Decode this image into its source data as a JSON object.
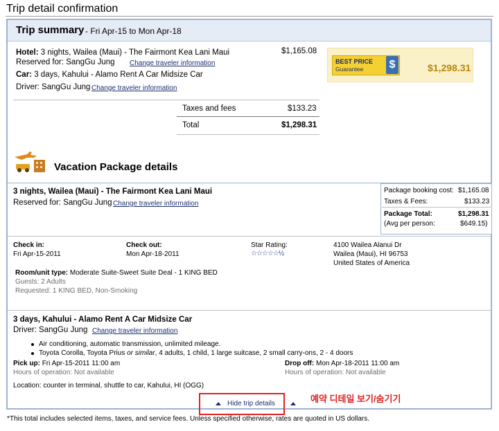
{
  "page_title": "Trip detail confirmation",
  "summary": {
    "title": "Trip summary",
    "dates": "- Fri Apr-15 to Mon Apr-18",
    "hotel_label": "Hotel:",
    "hotel_text": "3 nights, Wailea (Maui) - The Fairmont Kea Lani Maui",
    "hotel_price": "$1,165.08",
    "hotel_reserved": "Reserved for: SangGu  Jung",
    "change_link": "Change traveler information",
    "car_label": "Car:",
    "car_text": "3 days, Kahului - Alamo Rent A Car Midsize Car",
    "car_driver": "Driver: SangGu Jung",
    "taxes_label": "Taxes and fees",
    "taxes_value": "$133.23",
    "total_label": "Total",
    "total_value": "$1,298.31",
    "badge_line1": "BEST PRICE",
    "badge_line2": "Guarantee",
    "badge_symbol": "$",
    "box_total": "$1,298.31"
  },
  "vacation": {
    "title": "Vacation Package details",
    "hotel_heading": "3 nights, Wailea (Maui) - The Fairmont Kea Lani Maui",
    "hotel_reserved": "Reserved for: SangGu Jung",
    "cost_box": {
      "booking_label": "Package booking cost:",
      "booking_value": "$1,165.08",
      "taxes_label": "Taxes & Fees:",
      "taxes_value": "$133.23",
      "total_label": "Package Total:",
      "total_value": "$1,298.31",
      "avg_label": "(Avg per person:",
      "avg_value": "$649.15)"
    },
    "checkin_label": "Check in:",
    "checkin_value": "Fri Apr-15-2011",
    "checkout_label": "Check out:",
    "checkout_value": "Mon Apr-18-2011",
    "star_label": "Star Rating:",
    "star_value": "☆☆☆☆☆½",
    "address_line1": "4100 Wailea Alanui Dr",
    "address_line2": "Wailea (Maui), HI 96753",
    "address_line3": "United States of America",
    "room_label": "Room/unit type:",
    "room_value": "Moderate Suite-Sweet Suite Deal - 1 KING BED",
    "guests": "Guests: 2 Adults",
    "requested": "Requested: 1 KING BED, Non-Smoking",
    "car_heading": "3 days, Kahului - Alamo Rent A Car Midsize Car",
    "car_driver": "Driver: SangGu Jung",
    "car_feature1": "Air conditioning, automatic transmission, unlimited mileage.",
    "car_feature2_a": "Toyota Corolla, Toyota Prius",
    "car_feature2_b": "or similar",
    "car_feature2_c": ", 4 adults, 1 child, 1 large suitcase, 2 small carry-ons, 2 - 4 doors",
    "pickup_label": "Pick up:",
    "pickup_value": "Fri Apr-15-2011 11:00 am",
    "pickup_hours": "Hours of operation: Not available",
    "dropoff_label": "Drop off:",
    "dropoff_value": "Mon Apr-18-2011 11:00 am",
    "dropoff_hours": "Hours of operation: Not available",
    "location": "Location: counter in terminal, shuttle to car, Kahului, HI (OGG)"
  },
  "hide_link": "Hide trip details",
  "annotation": "예약 디테일 보기/숨기기",
  "footnote": "*This total includes selected items, taxes, and service fees. Unless specified otherwise, rates are quoted in US dollars.",
  "colors": {
    "accent_border": "#9db2d1",
    "header_bg": "#e5ecf6",
    "price_box": "#fbf1c9",
    "total_gold": "#b8860b",
    "annotation_red": "#e02020"
  }
}
